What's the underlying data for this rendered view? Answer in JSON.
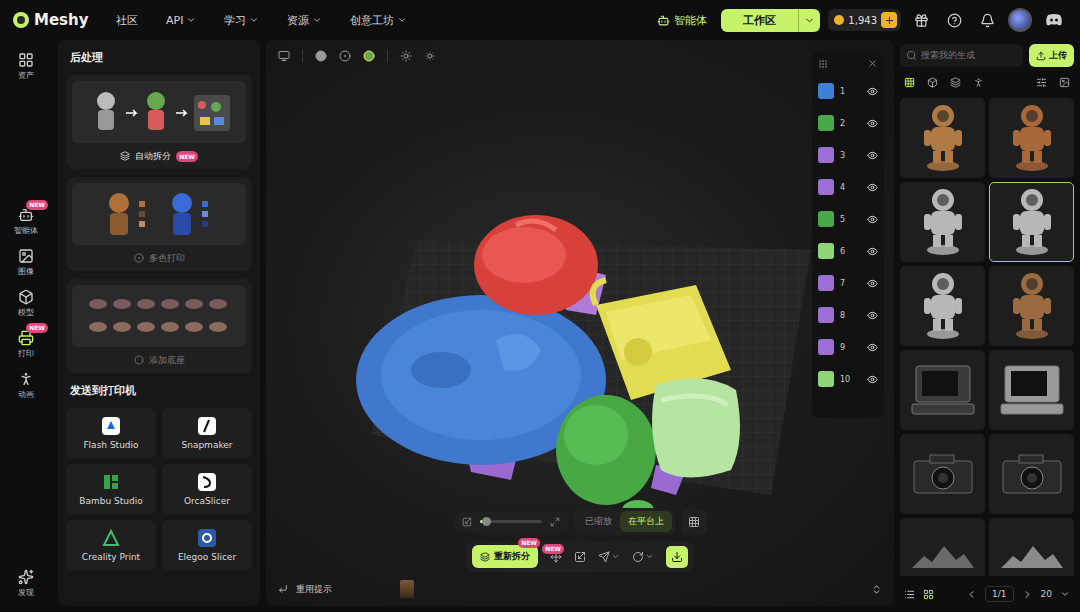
{
  "brand": {
    "name": "Meshy"
  },
  "nav": [
    {
      "label": "社区",
      "dropdown": false
    },
    {
      "label": "API",
      "dropdown": true
    },
    {
      "label": "学习",
      "dropdown": true
    },
    {
      "label": "资源",
      "dropdown": true
    },
    {
      "label": "创意工坊",
      "dropdown": true
    }
  ],
  "topbar": {
    "agent": "智能体",
    "workspace": "工作区",
    "credits": "1,943"
  },
  "rail": [
    {
      "label": "资产",
      "kind": "assets",
      "badge": "",
      "selected": false
    },
    {
      "label": "智能体",
      "kind": "agent",
      "badge": "NEW",
      "selected": false
    },
    {
      "label": "图像",
      "kind": "image",
      "badge": "",
      "selected": false
    },
    {
      "label": "模型",
      "kind": "model",
      "badge": "",
      "selected": false
    },
    {
      "label": "打印",
      "kind": "print",
      "badge": "NEW",
      "selected": true
    },
    {
      "label": "动画",
      "kind": "animate",
      "badge": "",
      "selected": false
    },
    {
      "label": "发现",
      "kind": "discover",
      "badge": "",
      "selected": false
    }
  ],
  "leftPanel": {
    "title": "后处理",
    "tools": [
      {
        "label": "自动拆分",
        "badge": "NEW",
        "disabled": false,
        "kind": "split"
      },
      {
        "label": "多色打印",
        "badge": "",
        "disabled": true,
        "kind": "multicolor"
      },
      {
        "label": "添加底座",
        "badge": "",
        "disabled": true,
        "kind": "base"
      }
    ],
    "sendTitle": "发送到打印机",
    "printers": [
      {
        "name": "Flash Studio",
        "kind": "flash"
      },
      {
        "name": "Snapmaker",
        "kind": "snap"
      },
      {
        "name": "Bambu Studio",
        "kind": "bambu"
      },
      {
        "name": "OrcaSlicer",
        "kind": "orca"
      },
      {
        "name": "Creality Print",
        "kind": "creality"
      },
      {
        "name": "Elegoo Slicer",
        "kind": "elegoo"
      }
    ]
  },
  "viewport": {
    "parts": [
      {
        "label": "1",
        "color": "#3f7fd6",
        "visible": true
      },
      {
        "label": "2",
        "color": "#4aa84a",
        "visible": true
      },
      {
        "label": "3",
        "color": "#9b6fd6",
        "visible": true
      },
      {
        "label": "4",
        "color": "#9b6fd6",
        "visible": true
      },
      {
        "label": "5",
        "color": "#4aa84a",
        "visible": true
      },
      {
        "label": "6",
        "color": "#8fd67a",
        "visible": true
      },
      {
        "label": "7",
        "color": "#9b6fd6",
        "visible": true
      },
      {
        "label": "8",
        "color": "#9b6fd6",
        "visible": true
      },
      {
        "label": "9",
        "color": "#9b6fd6",
        "visible": true
      },
      {
        "label": "10",
        "color": "#8fd67a",
        "visible": true
      }
    ],
    "slider": {
      "level": 0.1
    },
    "placement": [
      {
        "label": "已缩放",
        "selected": false
      },
      {
        "label": "在平台上",
        "selected": true
      }
    ],
    "resplit": {
      "label": "重新拆分",
      "badge": "NEW"
    },
    "toolBadge": "NEW",
    "reusePrompt": "重用提示"
  },
  "rightPanel": {
    "searchPlaceholder": "搜索我的生成",
    "upload": "上传",
    "thumbnails": [
      {
        "kind": "figure",
        "color": "#b07a45",
        "selected": false
      },
      {
        "kind": "figure",
        "color": "#a8683a",
        "selected": false
      },
      {
        "kind": "figure",
        "color": "#b8b8b8",
        "selected": false
      },
      {
        "kind": "figure",
        "color": "#b8b8b8",
        "selected": true
      },
      {
        "kind": "figure",
        "color": "#b8b8b8",
        "selected": false
      },
      {
        "kind": "figure",
        "color": "#9a6a40",
        "selected": false
      },
      {
        "kind": "monitor",
        "color": "#3a3a3a",
        "selected": false
      },
      {
        "kind": "monitor",
        "color": "#9a9a9a",
        "selected": false
      },
      {
        "kind": "camera",
        "color": "#2a2a2a",
        "selected": false
      },
      {
        "kind": "camera",
        "color": "#2a2a2a",
        "selected": false
      },
      {
        "kind": "landscape",
        "color": "#6a6a6a",
        "selected": false
      },
      {
        "kind": "landscape",
        "color": "#8a8a8a",
        "selected": false
      }
    ],
    "pagination": {
      "page": "1/1",
      "perPage": "20"
    }
  }
}
